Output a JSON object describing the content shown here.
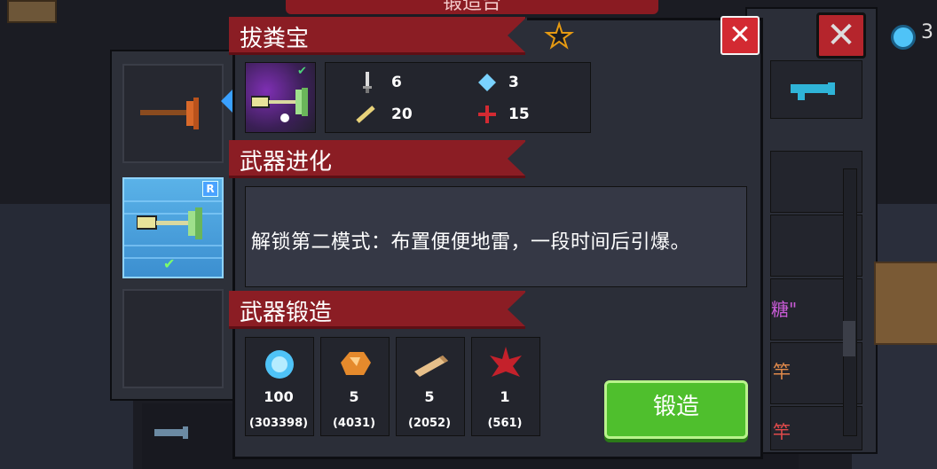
{
  "dialog": {
    "weapon_name": "拔粪宝",
    "evolution_title": "武器进化",
    "evolution_desc": "解锁第二模式：布置便便地雷，一段时间后引爆。",
    "forge_title": "武器锻造",
    "forge_button": "锻造",
    "close_icon": "close-icon",
    "favorite_icon": "star-outline-icon"
  },
  "stats": {
    "damage": "6",
    "energy_cost": "3",
    "crit_chance": "20",
    "spread": "15"
  },
  "materials": [
    {
      "name": "blue-gem-icon",
      "required": "100",
      "owned": "(303398)"
    },
    {
      "name": "ore-icon",
      "required": "5",
      "owned": "(4031)"
    },
    {
      "name": "wood-icon",
      "required": "5",
      "owned": "(2052)"
    },
    {
      "name": "red-leaf-icon",
      "required": "1",
      "owned": "(561)"
    }
  ],
  "weapon_list": {
    "selected_rarity_badge": "R"
  },
  "background": {
    "title": "锻造台",
    "list_items": [
      "糖\"",
      "竿",
      "竿"
    ],
    "coin_label": "3"
  },
  "colors": {
    "ribbon": "#8b1d24",
    "forge_button": "#4fbf2d",
    "close_button": "#d32a32",
    "selected_slot": "#4aa3e8"
  }
}
